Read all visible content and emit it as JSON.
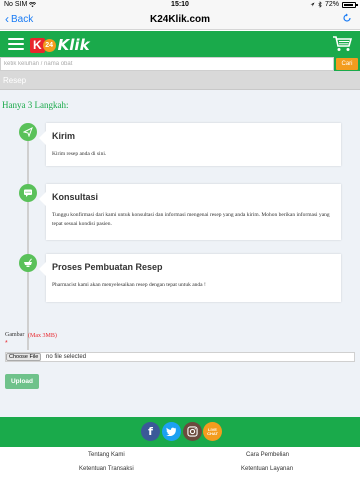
{
  "status_bar": {
    "carrier": "No SIM",
    "time": "15:10",
    "battery": "72%"
  },
  "browser": {
    "back_label": "Back",
    "url": "K24Klik.com"
  },
  "header": {
    "logo_badge": "24",
    "logo_letter": "K",
    "brand": "Klik"
  },
  "search": {
    "placeholder": "ketik keluhan / nama obat",
    "button_label": "Cari"
  },
  "breadcrumb": "Resep",
  "steps_title": "Hanya 3 Langkah:",
  "steps": [
    {
      "title": "Kirim",
      "description": "Kirim resep anda di sini.",
      "icon": "send-icon"
    },
    {
      "title": "Konsultasi",
      "description": "Tunggu konfirmasi dari kami untuk konsultasi dan informasi mengenai resep yang anda kirim. Mohon berikan informasi yang tepat sesuai kondisi pasien.",
      "icon": "chat-icon"
    },
    {
      "title": "Proses Pembuatan Resep",
      "description": "Pharmacist kami akan menyelesaikan resep dengan tepat untuk anda !",
      "icon": "mortar-icon"
    }
  ],
  "upload": {
    "label": "Gambar",
    "max_note": "(Max 3MB)",
    "required_mark": "*",
    "choose_label": "Choose File",
    "file_status": "no file selected",
    "upload_label": "Upload"
  },
  "social": {
    "live_chat_line1": "LIVE",
    "live_chat_line2": "CHAT"
  },
  "footer": {
    "links": [
      "Tentang Kami",
      "Cara Pembelian",
      "Ketentuan Transaksi",
      "Ketentuan Layanan"
    ]
  },
  "colors": {
    "brand_green": "#1aaa4b",
    "accent_orange": "#f39c1e",
    "accent_red": "#e8272d"
  }
}
